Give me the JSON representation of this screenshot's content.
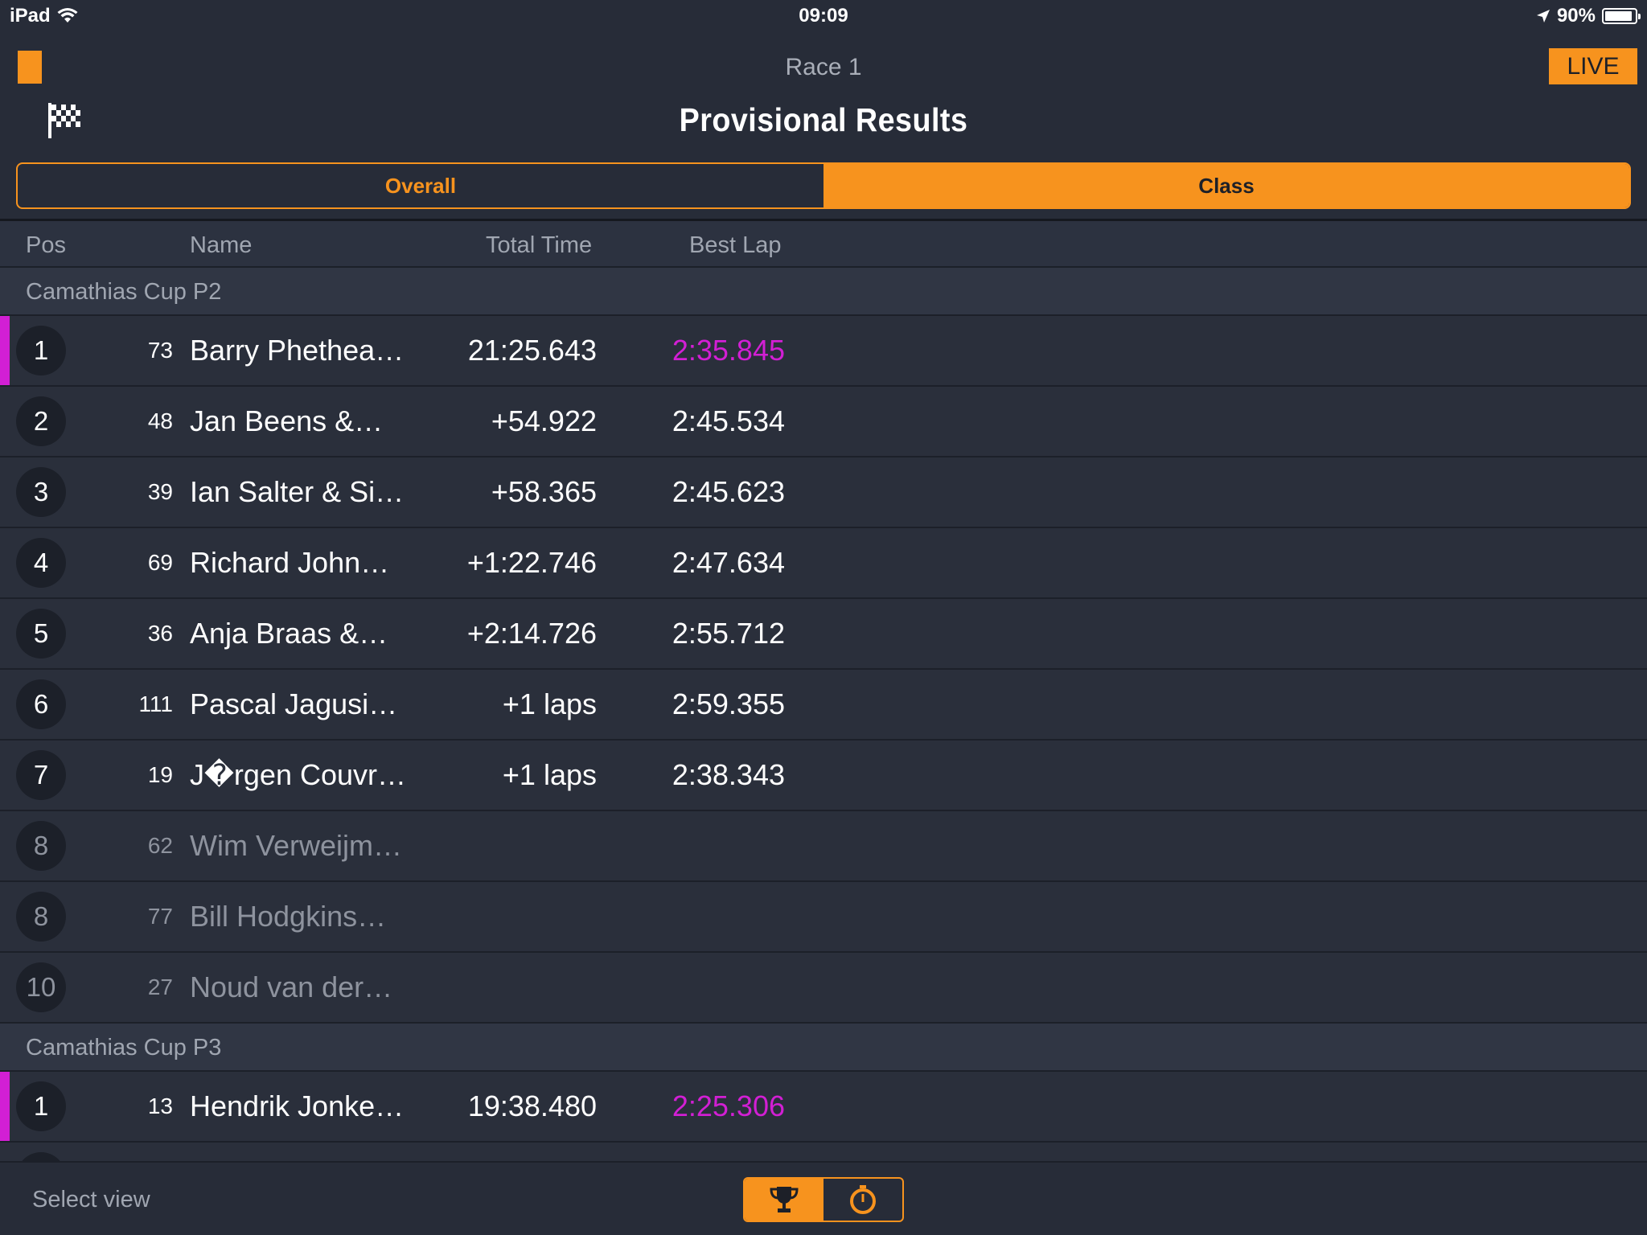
{
  "status_bar": {
    "device": "iPad",
    "time": "09:09",
    "battery": "90%"
  },
  "header": {
    "race": "Race 1",
    "live": "LIVE",
    "title": "Provisional Results"
  },
  "tabs": {
    "overall": "Overall",
    "class": "Class",
    "active": "class"
  },
  "columns": {
    "pos": "Pos",
    "name": "Name",
    "total": "Total Time",
    "best": "Best Lap"
  },
  "groups": [
    {
      "name": "Camathias Cup P2"
    },
    {
      "name": "Camathias Cup P3"
    }
  ],
  "results": [
    {
      "pos": "1",
      "num": "73",
      "name": "Barry Phethea…",
      "total": "21:25.643",
      "best": "2:35.845"
    },
    {
      "pos": "2",
      "num": "48",
      "name": "Jan Beens &…",
      "total": "+54.922",
      "best": "2:45.534"
    },
    {
      "pos": "3",
      "num": "39",
      "name": "Ian Salter & Si…",
      "total": "+58.365",
      "best": "2:45.623"
    },
    {
      "pos": "4",
      "num": "69",
      "name": "Richard John…",
      "total": "+1:22.746",
      "best": "2:47.634"
    },
    {
      "pos": "5",
      "num": "36",
      "name": "Anja Braas &…",
      "total": "+2:14.726",
      "best": "2:55.712"
    },
    {
      "pos": "6",
      "num": "111",
      "name": "Pascal Jagusi…",
      "total": "+1 laps",
      "best": "2:59.355"
    },
    {
      "pos": "7",
      "num": "19",
      "name": "J�rgen Couvr…",
      "total": "+1 laps",
      "best": "2:38.343"
    },
    {
      "pos": "8",
      "num": "62",
      "name": "Wim Verweijm…",
      "total": "",
      "best": ""
    },
    {
      "pos": "8",
      "num": "77",
      "name": "Bill Hodgkins…",
      "total": "",
      "best": ""
    },
    {
      "pos": "10",
      "num": "27",
      "name": "Noud van der…",
      "total": "",
      "best": ""
    },
    {
      "pos": "1",
      "num": "13",
      "name": "Hendrik Jonke…",
      "total": "19:38.480",
      "best": "2:25.306"
    }
  ],
  "footer": {
    "select_view": "Select view"
  },
  "colors": {
    "accent": "#f7931e",
    "fastest_lap": "#d21fd4",
    "background": "#272c38"
  },
  "icons": [
    "wifi-icon",
    "location-arrow-icon",
    "battery-icon",
    "checkered-flag-icon",
    "trophy-icon",
    "stopwatch-icon"
  ]
}
